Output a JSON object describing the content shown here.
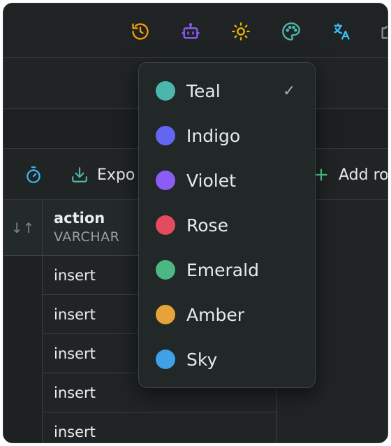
{
  "toolbar": {
    "icons": [
      {
        "name": "history-icon",
        "color": "#f59e0b"
      },
      {
        "name": "bot-icon",
        "color": "#8b5cf6"
      },
      {
        "name": "sun-icon",
        "color": "#eab308"
      },
      {
        "name": "palette-icon",
        "color": "#4db6ac"
      },
      {
        "name": "translate-icon",
        "color": "#38bdf8"
      }
    ]
  },
  "actions": {
    "timer_icon_color": "#38bdf8",
    "export_label": "Expo",
    "export_icon_color": "#4db6ac",
    "add_row_label": "Add ro",
    "add_icon_color": "#4ade80"
  },
  "table": {
    "sort_glyph": "↓↑",
    "column": {
      "name": "action",
      "type": "VARCHAR"
    },
    "rows": [
      "insert",
      "insert",
      "insert",
      "insert",
      "insert"
    ]
  },
  "theme_menu": {
    "selected": "Teal",
    "check_glyph": "✓",
    "options": [
      {
        "label": "Teal",
        "color": "#4db6ac"
      },
      {
        "label": "Indigo",
        "color": "#6366f1"
      },
      {
        "label": "Violet",
        "color": "#8b5cf6"
      },
      {
        "label": "Rose",
        "color": "#e34b5f"
      },
      {
        "label": "Emerald",
        "color": "#4cb782"
      },
      {
        "label": "Amber",
        "color": "#e8a23a"
      },
      {
        "label": "Sky",
        "color": "#3fa2e8"
      }
    ]
  }
}
